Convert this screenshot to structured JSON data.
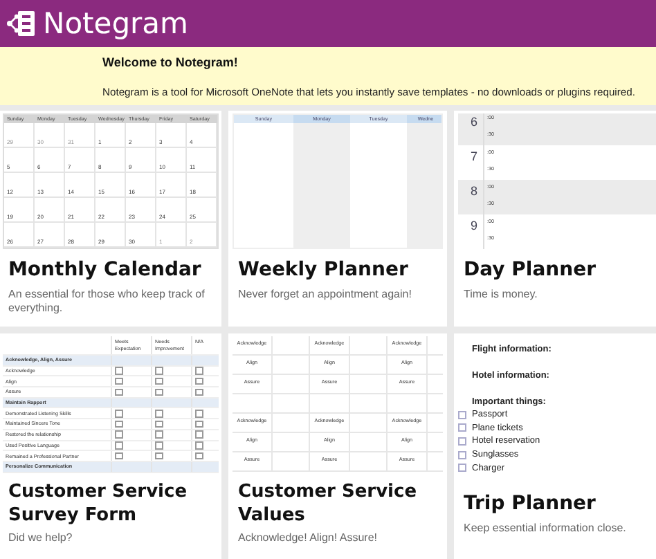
{
  "header": {
    "title": "Notegram"
  },
  "banner": {
    "heading": "Welcome to Notegram!",
    "text": "Notegram is a tool for Microsoft OneNote that lets you instantly save templates - no downloads or plugins required."
  },
  "cards": [
    {
      "kind": "monthly",
      "title": "Monthly Calendar",
      "description": "An essential for those who keep track of everything.",
      "preview": {
        "weekdays": [
          "Sunday",
          "Monday",
          "Tuesday",
          "Wednesday",
          "Thursday",
          "Friday",
          "Saturday"
        ],
        "weeks": [
          [
            {
              "day": "29",
              "outside": true
            },
            {
              "day": "30",
              "outside": true
            },
            {
              "day": "31",
              "outside": true
            },
            {
              "day": "1",
              "outside": false
            },
            {
              "day": "2",
              "outside": false
            },
            {
              "day": "3",
              "outside": false
            },
            {
              "day": "4",
              "outside": false
            }
          ],
          [
            {
              "day": "5",
              "outside": false
            },
            {
              "day": "6",
              "outside": false
            },
            {
              "day": "7",
              "outside": false
            },
            {
              "day": "8",
              "outside": false
            },
            {
              "day": "9",
              "outside": false
            },
            {
              "day": "10",
              "outside": false
            },
            {
              "day": "11",
              "outside": false
            }
          ],
          [
            {
              "day": "12",
              "outside": false
            },
            {
              "day": "13",
              "outside": false
            },
            {
              "day": "14",
              "outside": false
            },
            {
              "day": "15",
              "outside": false
            },
            {
              "day": "16",
              "outside": false
            },
            {
              "day": "17",
              "outside": false
            },
            {
              "day": "18",
              "outside": false
            }
          ],
          [
            {
              "day": "19",
              "outside": false
            },
            {
              "day": "20",
              "outside": false
            },
            {
              "day": "21",
              "outside": false
            },
            {
              "day": "22",
              "outside": false
            },
            {
              "day": "23",
              "outside": false
            },
            {
              "day": "24",
              "outside": false
            },
            {
              "day": "25",
              "outside": false
            }
          ],
          [
            {
              "day": "26",
              "outside": false
            },
            {
              "day": "27",
              "outside": false
            },
            {
              "day": "28",
              "outside": false
            },
            {
              "day": "29",
              "outside": false
            },
            {
              "day": "30",
              "outside": false
            },
            {
              "day": "1",
              "outside": true
            },
            {
              "day": "2",
              "outside": true
            }
          ]
        ]
      }
    },
    {
      "kind": "weekly",
      "title": "Weekly Planner",
      "description": "Never forget an appointment again!",
      "preview": {
        "columns": [
          {
            "label": "Sunday",
            "shaded": false
          },
          {
            "label": "Monday",
            "shaded": true
          },
          {
            "label": "Tuesday",
            "shaded": false
          },
          {
            "label": "Wedne",
            "shaded": true
          }
        ]
      }
    },
    {
      "kind": "daily",
      "title": "Day Planner",
      "description": "Time is money.",
      "preview": {
        "hours": [
          {
            "hour": "6",
            "shaded": true,
            "minutes": [
              ":00",
              ":30"
            ]
          },
          {
            "hour": "7",
            "shaded": false,
            "minutes": [
              ":00",
              ":30"
            ]
          },
          {
            "hour": "8",
            "shaded": true,
            "minutes": [
              ":00",
              ":30"
            ]
          },
          {
            "hour": "9",
            "shaded": false,
            "minutes": [
              ":00",
              ":30"
            ]
          }
        ]
      }
    },
    {
      "kind": "survey",
      "title": "Customer Service Survey Form",
      "description": "Did we help?",
      "preview": {
        "columns": [
          "Meets Expectation",
          "Needs Improvement",
          "N/A"
        ],
        "sections": [
          {
            "title": "Acknowledge, Align, Assure",
            "rows": [
              {
                "label": "Acknowledge",
                "checked": [
                  false,
                  false,
                  false
                ]
              },
              {
                "label": "Align",
                "checked": [
                  false,
                  false,
                  false
                ]
              },
              {
                "label": "Assure",
                "checked": [
                  false,
                  false,
                  false
                ]
              }
            ]
          },
          {
            "title": "Maintain Rapport",
            "rows": [
              {
                "label": "Demonstrated Listening Skills",
                "checked": [
                  false,
                  false,
                  false
                ]
              },
              {
                "label": "Maintained Sincere Tone",
                "checked": [
                  false,
                  false,
                  false
                ]
              },
              {
                "label": "Restored the relationship",
                "checked": [
                  false,
                  false,
                  false
                ]
              },
              {
                "label": "Used Positive Language",
                "checked": [
                  false,
                  false,
                  false
                ]
              },
              {
                "label": "Remained a Professional Partner",
                "checked": [
                  false,
                  false,
                  false
                ]
              }
            ]
          },
          {
            "title": "Personalize Communication"
          }
        ]
      }
    },
    {
      "kind": "values",
      "title": "Customer Service Values",
      "description": "Acknowledge! Align! Assure!",
      "preview": {
        "groups": [
          [
            [
              "Acknowledge",
              "Acknowledge",
              "Acknowledge"
            ],
            [
              "Align",
              "Align",
              "Align"
            ],
            [
              "Assure",
              "Assure",
              "Assure"
            ]
          ],
          [
            [
              "Acknowledge",
              "Acknowledge",
              "Acknowledge"
            ],
            [
              "Align",
              "Align",
              "Align"
            ],
            [
              "Assure",
              "Assure",
              "Assure"
            ]
          ]
        ]
      }
    },
    {
      "kind": "trip",
      "title": "Trip Planner",
      "description": "Keep essential information close.",
      "preview": {
        "fields": [
          "Flight information:",
          "Hotel information:"
        ],
        "list_heading": "Important things:",
        "items": [
          {
            "label": "Passport",
            "checked": false
          },
          {
            "label": "Plane tickets",
            "checked": false
          },
          {
            "label": "Hotel reservation",
            "checked": false
          },
          {
            "label": "Sunglasses",
            "checked": false
          },
          {
            "label": "Charger",
            "checked": false
          }
        ]
      }
    }
  ]
}
